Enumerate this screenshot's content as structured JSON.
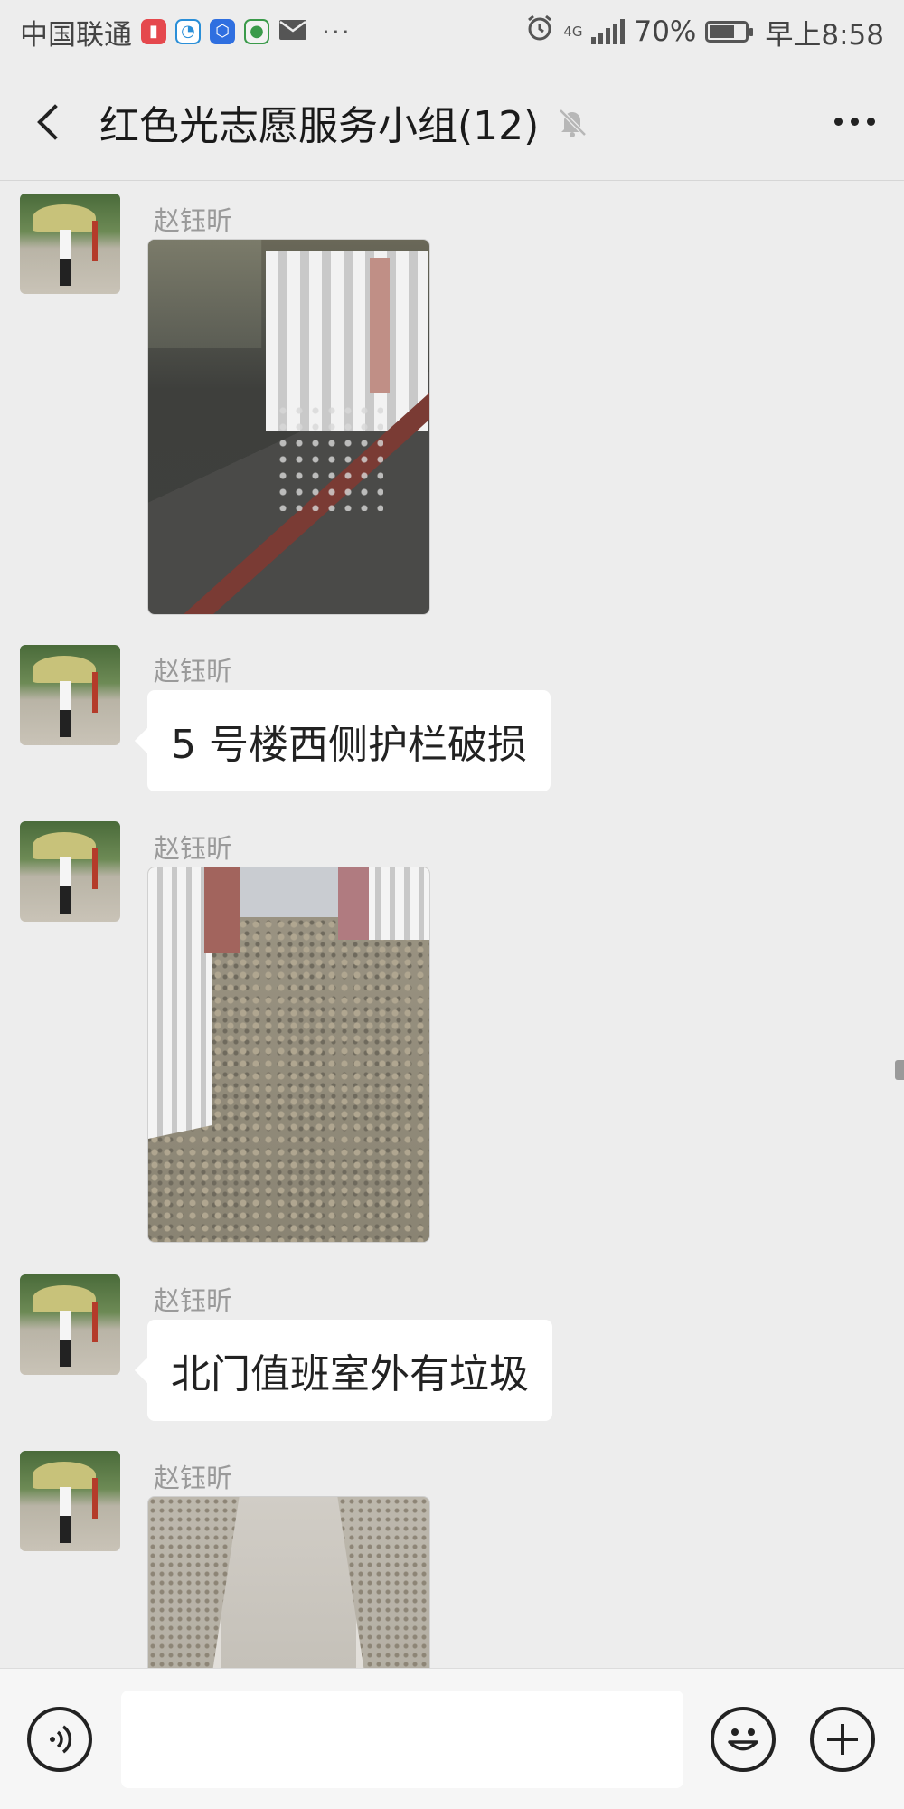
{
  "status_bar": {
    "carrier": "中国联通",
    "network": "4G",
    "battery": "70%",
    "battery_level": 0.7,
    "time": "早上8:58",
    "more": "···"
  },
  "nav": {
    "title": "红色光志愿服务小组(12)"
  },
  "messages": [
    {
      "type": "image",
      "sender": "赵钰昕",
      "image_desc": "gate-corner-debris-photo"
    },
    {
      "type": "text",
      "sender": "赵钰昕",
      "text": "5 号楼西侧护栏破损"
    },
    {
      "type": "image",
      "sender": "赵钰昕",
      "image_desc": "rubble-corner-photo"
    },
    {
      "type": "text",
      "sender": "赵钰昕",
      "text": "北门值班室外有垃圾"
    },
    {
      "type": "image",
      "sender": "赵钰昕",
      "image_desc": "path-debris-photo"
    }
  ],
  "input": {
    "placeholder": ""
  },
  "colors": {
    "background": "#ededed",
    "bubble": "#ffffff",
    "sender": "#9a9a9a",
    "input_bar": "#f6f6f6"
  }
}
